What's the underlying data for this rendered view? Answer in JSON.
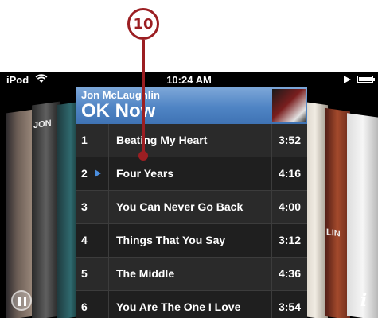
{
  "callout": {
    "number": "10"
  },
  "status_bar": {
    "device": "iPod",
    "time": "10:24 AM",
    "wifi_icon": "wifi-icon",
    "play_icon": "play-icon",
    "battery_icon": "battery-icon"
  },
  "album": {
    "artist": "Jon McLaughlin",
    "title": "OK Now"
  },
  "covers": {
    "left_text": "JON",
    "right_text": "LIN"
  },
  "tracks": [
    {
      "number": "1",
      "title": "Beating My Heart",
      "duration": "3:52",
      "now_playing": false
    },
    {
      "number": "2",
      "title": "Four Years",
      "duration": "4:16",
      "now_playing": true
    },
    {
      "number": "3",
      "title": "You Can Never Go Back",
      "duration": "4:00",
      "now_playing": false
    },
    {
      "number": "4",
      "title": "Things That You Say",
      "duration": "3:12",
      "now_playing": false
    },
    {
      "number": "5",
      "title": "The Middle",
      "duration": "4:36",
      "now_playing": false
    },
    {
      "number": "6",
      "title": "You Are The One I Love",
      "duration": "3:54",
      "now_playing": false
    }
  ],
  "controls": {
    "pause_icon": "pause-icon",
    "info_label": "i"
  },
  "colors": {
    "callout": "#9b1e22",
    "header_blue": "#4f84c4",
    "now_playing_blue": "#4b8fe0"
  }
}
